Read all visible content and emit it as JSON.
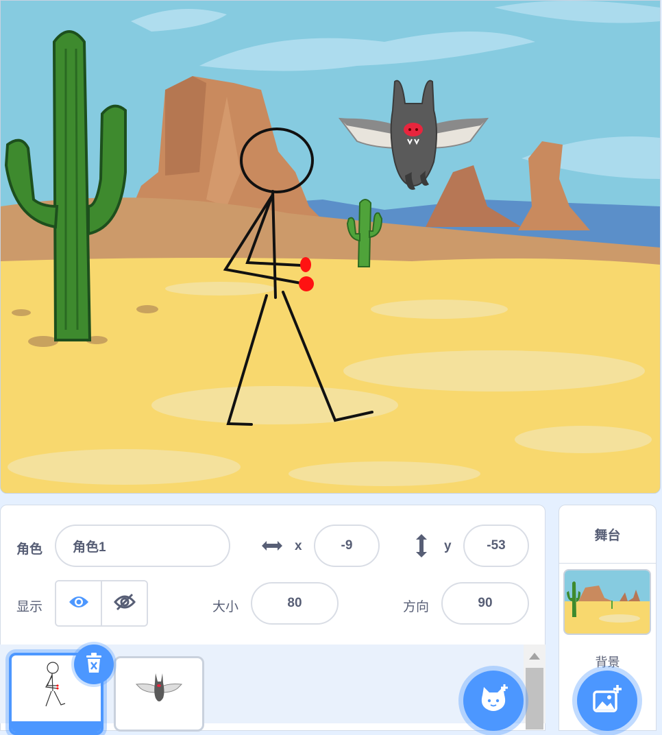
{
  "sprite_info": {
    "sprite_label": "角色",
    "sprite_name": "角色1",
    "x_label": "x",
    "x_value": "-9",
    "y_label": "y",
    "y_value": "-53",
    "show_label": "显示",
    "size_label": "大小",
    "size_value": "80",
    "direction_label": "方向",
    "direction_value": "90",
    "visible": true
  },
  "sprites": [
    {
      "name": "stickman-sprite",
      "selected": true
    },
    {
      "name": "bat-sprite",
      "selected": false
    }
  ],
  "stage_panel": {
    "title": "舞台",
    "backdrops_label": "背景"
  },
  "colors": {
    "accent": "#4c97ff",
    "text": "#575e75",
    "sky": "#86cbe0",
    "sand": "#f8d86e",
    "mesa": "#c98a5e"
  },
  "icons": [
    "move-horizontal-icon",
    "move-vertical-icon",
    "eye-icon",
    "eye-slash-icon",
    "trash-icon",
    "cat-add-icon",
    "image-add-icon"
  ]
}
